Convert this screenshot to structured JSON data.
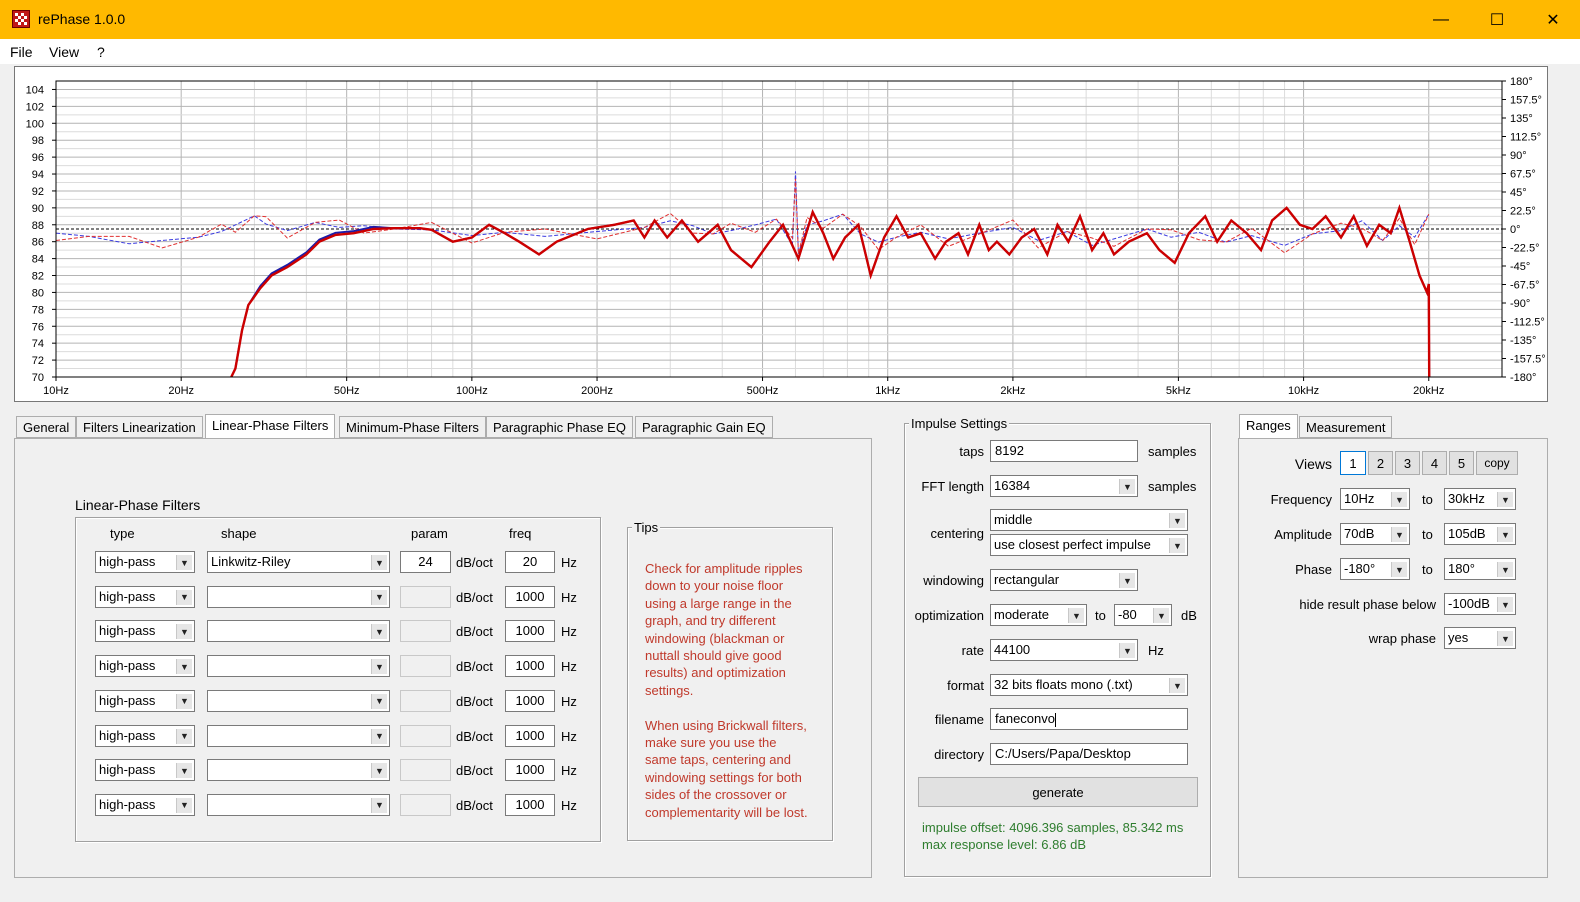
{
  "window": {
    "title": "rePhase 1.0.0",
    "minimize": "—",
    "maximize": "☐",
    "close": "✕"
  },
  "menu": {
    "file": "File",
    "view": "View",
    "help": "?"
  },
  "graph": {
    "amplitude_ticks": [
      "104",
      "102",
      "100",
      "98",
      "96",
      "94",
      "92",
      "90",
      "88",
      "86",
      "84",
      "82",
      "80",
      "78",
      "76",
      "74",
      "72",
      "70"
    ],
    "phase_ticks": [
      "180°",
      "157.5°",
      "135°",
      "112.5°",
      "90°",
      "67.5°",
      "45°",
      "22.5°",
      "0°",
      "-22.5°",
      "-45°",
      "-67.5°",
      "-90°",
      "-112.5°",
      "-135°",
      "-157.5°",
      "-180°"
    ],
    "freq_ticks": [
      "10Hz",
      "20Hz",
      "50Hz",
      "100Hz",
      "200Hz",
      "500Hz",
      "1kHz",
      "2kHz",
      "5kHz",
      "10kHz",
      "20kHz"
    ],
    "colors": {
      "amplitude_red": "#cc0000",
      "amplitude_blue": "#1c1ca8",
      "phase_red": "#e03030",
      "phase_blue": "#3a3ae0",
      "grid_minor": "#dcdcdc",
      "grid_major": "#b4b4b4"
    }
  },
  "tabs": [
    "General",
    "Filters Linearization",
    "Linear-Phase Filters",
    "Minimum-Phase Filters",
    "Paragraphic Phase EQ",
    "Paragraphic Gain EQ"
  ],
  "active_tab": "Linear-Phase Filters",
  "linear_phase": {
    "group_title": "Linear-Phase Filters",
    "headers": {
      "type": "type",
      "shape": "shape",
      "param": "param",
      "freq": "freq"
    },
    "unit_param": "dB/oct",
    "unit_freq": "Hz",
    "rows": [
      {
        "type": "high-pass",
        "shape": "Linkwitz-Riley",
        "param": "24",
        "freq": "20"
      },
      {
        "type": "high-pass",
        "shape": "",
        "param": "",
        "freq": "1000"
      },
      {
        "type": "high-pass",
        "shape": "",
        "param": "",
        "freq": "1000"
      },
      {
        "type": "high-pass",
        "shape": "",
        "param": "",
        "freq": "1000"
      },
      {
        "type": "high-pass",
        "shape": "",
        "param": "",
        "freq": "1000"
      },
      {
        "type": "high-pass",
        "shape": "",
        "param": "",
        "freq": "1000"
      },
      {
        "type": "high-pass",
        "shape": "",
        "param": "",
        "freq": "1000"
      },
      {
        "type": "high-pass",
        "shape": "",
        "param": "",
        "freq": "1000"
      }
    ]
  },
  "tips": {
    "title": "Tips",
    "text": "Check for amplitude ripples\ndown to your noise floor\nusing a large range in the\ngraph, and try different\nwindowing (blackman or\nnuttall should give good\nresults) and optimization\nsettings.\n\nWhen using Brickwall filters,\nmake sure you use the\nsame taps, centering and\nwindowing settings for both\nsides of the crossover or\ncomplementarity will be lost."
  },
  "impulse": {
    "title": "Impulse Settings",
    "taps_label": "taps",
    "taps": "8192",
    "taps_unit": "samples",
    "fft_label": "FFT length",
    "fft": "16384",
    "fft_unit": "samples",
    "centering_label": "centering",
    "centering": "middle",
    "centering2": "use closest perfect impulse",
    "windowing_label": "windowing",
    "windowing": "rectangular",
    "optimization_label": "optimization",
    "optimization": "moderate",
    "opt_to": "to",
    "opt_db": "-80",
    "opt_unit": "dB",
    "rate_label": "rate",
    "rate": "44100",
    "rate_unit": "Hz",
    "format_label": "format",
    "format": "32 bits floats mono (.txt)",
    "filename_label": "filename",
    "filename": "faneconvo",
    "directory_label": "directory",
    "directory": "C:/Users/Papa/Desktop",
    "generate": "generate",
    "status_offset": "impulse offset: 4096.396 samples, 85.342 ms",
    "status_level": "max response level: 6.86 dB"
  },
  "right_tabs": [
    "Ranges",
    "Measurement"
  ],
  "ranges": {
    "views_label": "Views",
    "views": [
      "1",
      "2",
      "3",
      "4",
      "5"
    ],
    "copy": "copy",
    "frequency_label": "Frequency",
    "freq_from": "10Hz",
    "freq_to": "30kHz",
    "amplitude_label": "Amplitude",
    "amp_from": "70dB",
    "amp_to": "105dB",
    "phase_label": "Phase",
    "phase_from": "-180°",
    "phase_to": "180°",
    "to": "to",
    "hide_label": "hide result phase below",
    "hide": "-100dB",
    "wrap_label": "wrap phase",
    "wrap": "yes"
  }
}
